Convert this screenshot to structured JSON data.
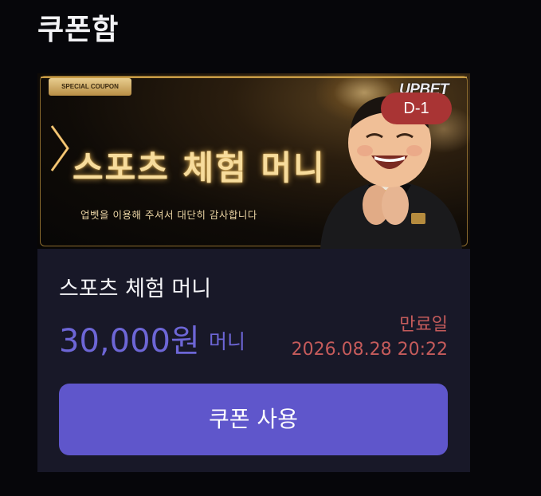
{
  "page": {
    "title": "쿠폰함"
  },
  "coupon": {
    "banner": {
      "badge": "SPECIAL COUPON",
      "brand": "UPBET",
      "headline": "스포츠 체험 머니",
      "subline": "업벳을 이용해 주셔서 대단히 감사합니다"
    },
    "dday": "D-1",
    "name": "스포츠 체험 머니",
    "amount": "30,000원",
    "amount_unit": "머니",
    "expiry_label": "만료일",
    "expiry_date": "2026.08.28 20:22",
    "use_button_label": "쿠폰 사용"
  },
  "colors": {
    "background": "#06060a",
    "card": "#181828",
    "accent": "#5f56cb",
    "amount": "#6d66d6",
    "expiry": "#c55b5b",
    "dday_badge": "#a93434",
    "banner_gold": "#f7dc9c"
  },
  "icons": {
    "banner_chevron": "chevron-right-icon",
    "mascot": "mascot-illustration"
  }
}
